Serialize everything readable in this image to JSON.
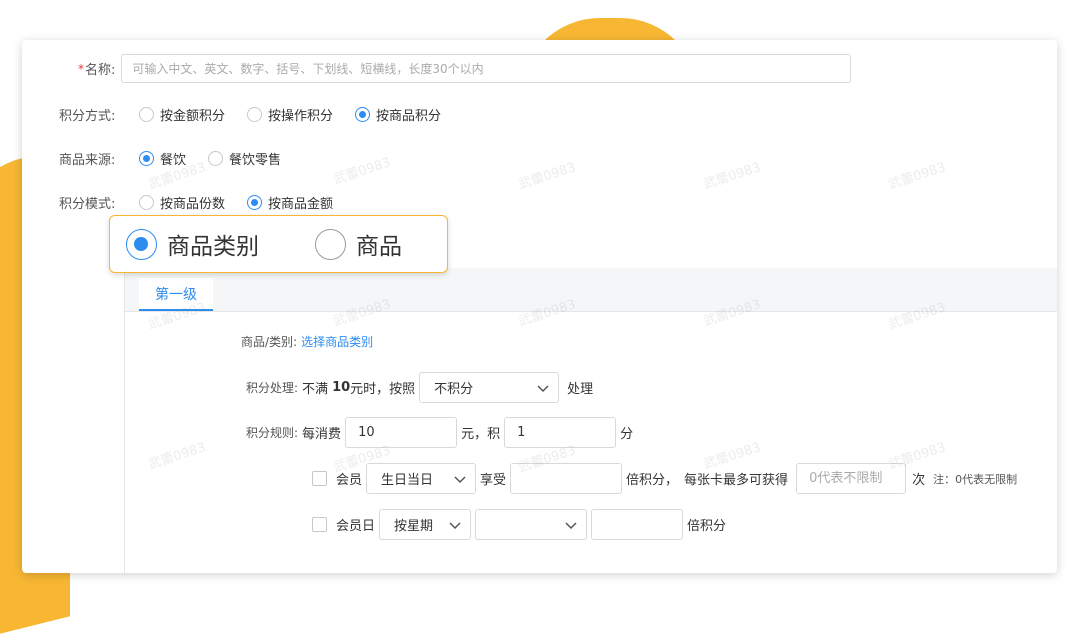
{
  "form": {
    "name": {
      "required_mark": "*",
      "label": "名称:",
      "placeholder": "可输入中文、英文、数字、括号、下划线、短横线，长度30个以内",
      "value": ""
    },
    "points_method": {
      "label": "积分方式:",
      "options": [
        "按金额积分",
        "按操作积分",
        "按商品积分"
      ],
      "selected_index": 2
    },
    "goods_source": {
      "label": "商品来源:",
      "options": [
        "餐饮",
        "餐饮零售"
      ],
      "selected_index": 0
    },
    "points_mode": {
      "label": "积分模式:",
      "options": [
        "按商品份数",
        "按商品金额"
      ],
      "selected_index": 1
    }
  },
  "callout": {
    "options": [
      "商品类别",
      "商品"
    ],
    "selected_index": 0
  },
  "panel": {
    "tab_label": "第一级",
    "goods_category": {
      "label": "商品/类别:",
      "link": "选择商品类别"
    },
    "points_handling": {
      "label": "积分处理:",
      "text_prefix": "不满",
      "amount": "10",
      "text_middle": "元时，按照",
      "select_value": "不积分",
      "text_suffix": "处理"
    },
    "points_rule": {
      "label": "积分规则:",
      "text_prefix": "每消费",
      "spend_value": "10",
      "text_middle": "元，积",
      "points_value": "1",
      "text_suffix": "分"
    },
    "member_row": {
      "label": "会员",
      "select_value": "生日当日",
      "enjoy": "享受",
      "multiplier_value": "",
      "text_after": "倍积分，",
      "text_max": "每张卡最多可获得",
      "max_placeholder": "0代表不限制",
      "times": "次",
      "note": "注：0代表无限制"
    },
    "member_day_row": {
      "label": "会员日",
      "select_value": "按星期",
      "second_select_value": "",
      "multiplier_value": "",
      "text_after": "倍积分"
    }
  },
  "watermark_text": "武蕾0983",
  "colors": {
    "accent": "#2d8cf0",
    "decor": "#f7b733",
    "required": "#e4393c"
  }
}
